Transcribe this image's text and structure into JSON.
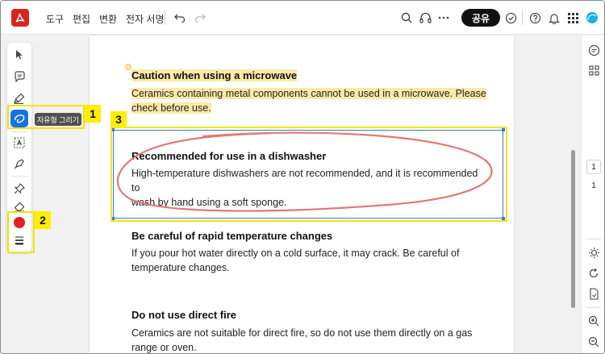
{
  "app": {
    "menu": [
      "도구",
      "편집",
      "변환",
      "전자 서명"
    ],
    "share_label": "공유",
    "colors": {
      "brand": "#d7261e",
      "accent": "#1473e6",
      "highlight": "#fde9a6",
      "ink": "#e07a74",
      "annotation": "#ffee00"
    }
  },
  "left_toolbar": {
    "tooltip": "자유형 그리기",
    "color_swatch": "#e02020"
  },
  "callouts": {
    "one": "1",
    "two": "2",
    "three": "3"
  },
  "document": {
    "sections": [
      {
        "heading": "Caution when using a microwave",
        "body": "Ceramics containing metal components cannot be used in a microwave. Please check before use.",
        "body_line1": "Ceramics containing metal components cannot be used in a microwave. Please",
        "body_line2": "check before use."
      },
      {
        "heading": "Recommended for use in a dishwasher",
        "body_line1": "High-temperature dishwashers are not recommended, and it is recommended to",
        "body_line2": "wash by hand using a soft sponge."
      },
      {
        "heading": "Be careful of rapid temperature changes",
        "body_line1": "If you pour hot water directly on a cold surface, it may crack. Be careful of",
        "body_line2": "temperature changes."
      },
      {
        "heading": "Do not use direct fire",
        "body_line1": "Ceramics are not suitable for direct fire, so do not use them directly on a gas",
        "body_line2": "range or oven."
      }
    ]
  },
  "right_rail": {
    "current_page": "1",
    "total_pages": "1"
  }
}
